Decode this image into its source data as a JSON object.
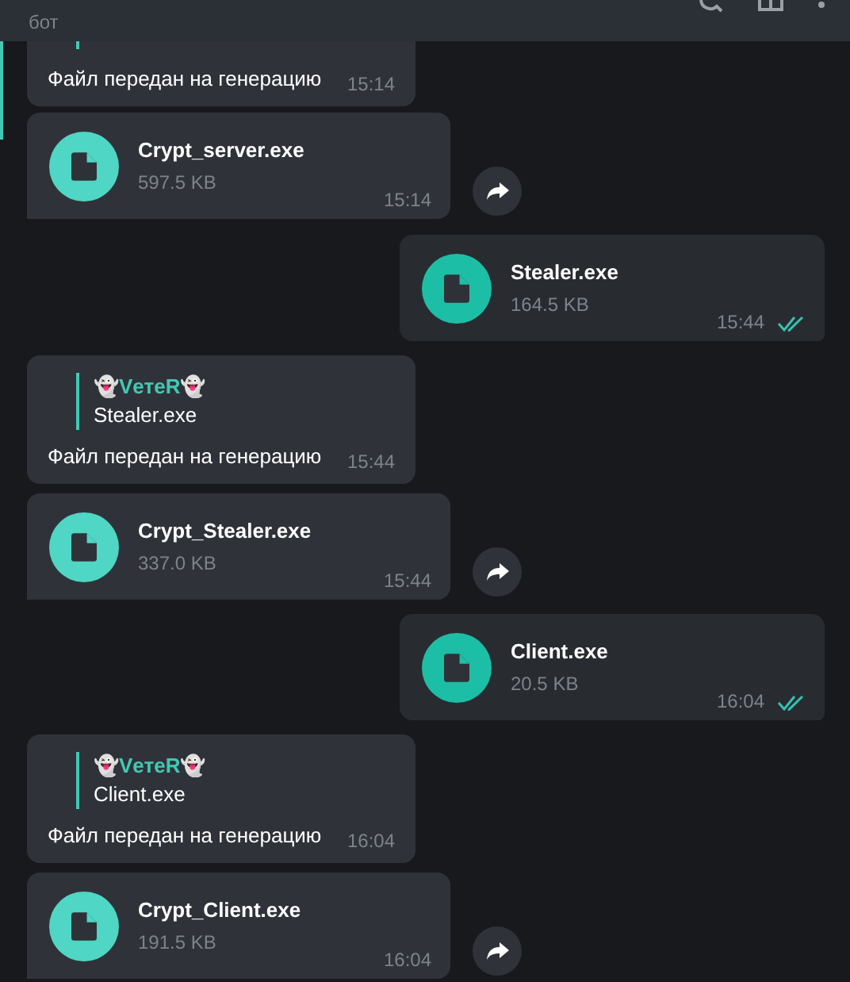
{
  "header": {
    "subtitle": "бот"
  },
  "messages": [
    {
      "kind": "reply_text",
      "outgoing": false,
      "partial": true,
      "text": "Файл передан на генерацию",
      "time": "15:14"
    },
    {
      "kind": "file",
      "outgoing": false,
      "name": "Crypt_server.exe",
      "size": "597.5 KB",
      "time": "15:14",
      "forward": true
    },
    {
      "kind": "file",
      "outgoing": true,
      "name": "Stealer.exe",
      "size": "164.5 KB",
      "time": "15:44",
      "read": true
    },
    {
      "kind": "reply_text",
      "outgoing": false,
      "partial": false,
      "reply_author": "👻VетеR👻",
      "reply_text": "Stealer.exe",
      "text": "Файл передан на генерацию",
      "time": "15:44"
    },
    {
      "kind": "file",
      "outgoing": false,
      "name": "Crypt_Stealer.exe",
      "size": "337.0 KB",
      "time": "15:44",
      "forward": true
    },
    {
      "kind": "file",
      "outgoing": true,
      "name": "Client.exe",
      "size": "20.5 KB",
      "time": "16:04",
      "read": true
    },
    {
      "kind": "reply_text",
      "outgoing": false,
      "partial": false,
      "reply_author": "👻VетеR👻",
      "reply_text": "Client.exe",
      "text": "Файл передан на генерацию",
      "time": "16:04"
    },
    {
      "kind": "file",
      "outgoing": false,
      "name": "Crypt_Client.exe",
      "size": "191.5 KB",
      "time": "16:04",
      "forward": true
    }
  ]
}
